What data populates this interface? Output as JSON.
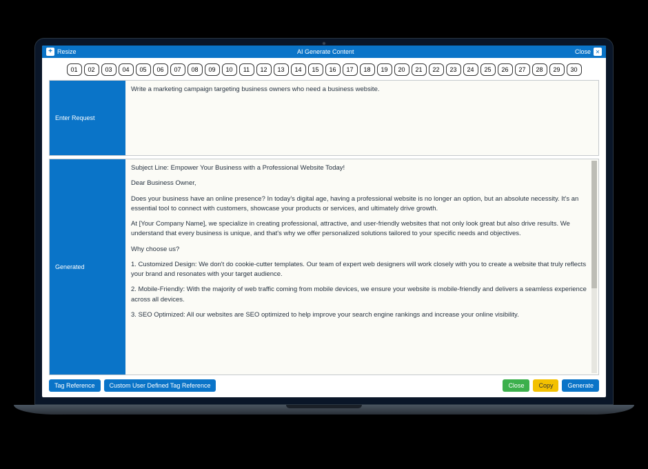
{
  "titlebar": {
    "resize_label": "Resize",
    "title": "AI Generate Content",
    "close_label": "Close"
  },
  "step_numbers": [
    "01",
    "02",
    "03",
    "04",
    "05",
    "06",
    "07",
    "08",
    "09",
    "10",
    "11",
    "12",
    "13",
    "14",
    "15",
    "16",
    "17",
    "18",
    "19",
    "20",
    "21",
    "22",
    "23",
    "24",
    "25",
    "26",
    "27",
    "28",
    "29",
    "30"
  ],
  "request_panel": {
    "label": "Enter Request",
    "value": "Write a marketing campaign targeting business owners who need a business website."
  },
  "generated_panel": {
    "label": "Generated",
    "paragraphs": [
      "Subject Line: Empower Your Business with a Professional Website Today!",
      "Dear Business Owner,",
      "Does your business have an online presence? In today's digital age, having a professional website is no longer an option, but an absolute necessity. It's an essential tool to connect with customers, showcase your products or services, and ultimately drive growth.",
      "At [Your Company Name], we specialize in creating professional, attractive, and user-friendly websites that not only look great but also drive results. We understand that every business is unique, and that's why we offer personalized solutions tailored to your specific needs and objectives.",
      "Why choose us?",
      "1. Customized Design: We don't do cookie-cutter templates. Our team of expert web designers will work closely with you to create a website that truly reflects your brand and resonates with your target audience.",
      "2. Mobile-Friendly: With the majority of web traffic coming from mobile devices, we ensure your website is mobile-friendly and delivers a seamless experience across all devices.",
      "3. SEO Optimized: All our websites are SEO optimized to help improve your search engine rankings and increase your online visibility."
    ]
  },
  "footer": {
    "tag_ref": "Tag Reference",
    "custom_tag_ref": "Custom User Defined Tag Reference",
    "close": "Close",
    "copy": "Copy",
    "generate": "Generate"
  }
}
